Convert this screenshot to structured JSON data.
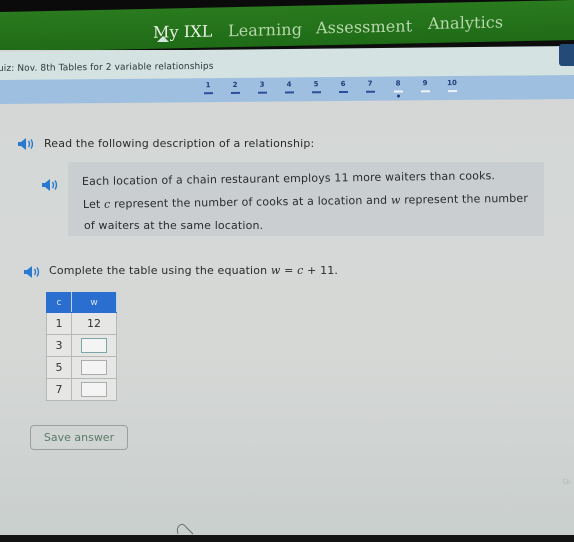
{
  "nav": {
    "items": [
      {
        "label": "My IXL",
        "active": true
      },
      {
        "label": "Learning",
        "active": false
      },
      {
        "label": "Assessment",
        "active": false
      },
      {
        "label": "Analytics",
        "active": false
      }
    ]
  },
  "quiz": {
    "title": "uiz: Nov. 8th Tables for 2 variable relationships",
    "questions": [
      {
        "num": "1",
        "status": "answered"
      },
      {
        "num": "2",
        "status": "answered"
      },
      {
        "num": "3",
        "status": "answered"
      },
      {
        "num": "4",
        "status": "answered"
      },
      {
        "num": "5",
        "status": "answered"
      },
      {
        "num": "6",
        "status": "answered"
      },
      {
        "num": "7",
        "status": "answered"
      },
      {
        "num": "8",
        "status": "current"
      },
      {
        "num": "9",
        "status": "unanswered"
      },
      {
        "num": "10",
        "status": "unanswered"
      }
    ]
  },
  "problem": {
    "intro": "Read the following description of a relationship:",
    "description_line1": "Each location of a chain restaurant employs 11 more waiters than cooks.",
    "description_line2_a": "Let ",
    "var_c": "c",
    "description_line2_b": " represent the number of cooks at a location and ",
    "var_w": "w",
    "description_line2_c": " represent the number",
    "description_line3": "of waiters at the same location.",
    "instruction_a": "Complete the table using the equation ",
    "equation_w": "w",
    "equation_mid": " = ",
    "equation_c": "c",
    "equation_end": " + 11."
  },
  "table": {
    "headers": [
      "c",
      "w"
    ],
    "rows": [
      {
        "c": "1",
        "w": "12",
        "editable": false
      },
      {
        "c": "3",
        "w": "",
        "editable": true
      },
      {
        "c": "5",
        "w": "",
        "editable": true
      },
      {
        "c": "7",
        "w": "",
        "editable": true
      }
    ]
  },
  "buttons": {
    "save": "Save answer"
  },
  "colors": {
    "nav_green": "#237419",
    "table_header_blue": "#2a6fd0",
    "speaker_blue": "#2a78d0",
    "question_nav_bg": "#9fbfe0"
  },
  "corner_text": "Sk"
}
